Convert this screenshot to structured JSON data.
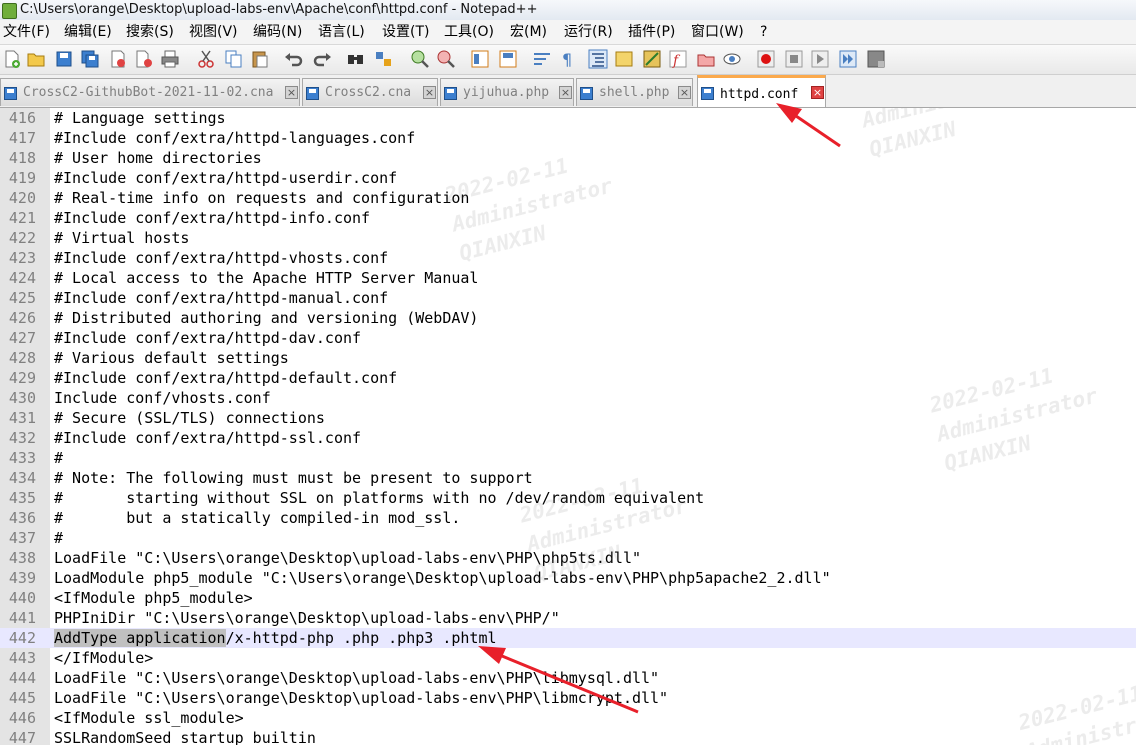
{
  "window": {
    "title": "C:\\Users\\orange\\Desktop\\upload-labs-env\\Apache\\conf\\httpd.conf - Notepad++"
  },
  "menu": [
    "文件(F)",
    "编辑(E)",
    "搜索(S)",
    "视图(V)",
    "编码(N)",
    "语言(L)",
    "设置(T)",
    "工具(O)",
    "宏(M)",
    "运行(R)",
    "插件(P)",
    "窗口(W)",
    "?"
  ],
  "tabs": [
    {
      "label": "CrossC2-GithubBot-2021-11-02.cna",
      "active": false
    },
    {
      "label": "CrossC2.cna",
      "active": false
    },
    {
      "label": "yijuhua.php",
      "active": false
    },
    {
      "label": "shell.php",
      "active": false
    },
    {
      "label": "httpd.conf",
      "active": true
    }
  ],
  "watermark": {
    "date": "2022-02-11",
    "user": "Administrator",
    "org": "QIANXIN"
  },
  "editor": {
    "current_line": "442",
    "lines": [
      {
        "num": "416",
        "text": "# Language settings"
      },
      {
        "num": "417",
        "text": "#Include conf/extra/httpd-languages.conf"
      },
      {
        "num": "418",
        "text": "# User home directories"
      },
      {
        "num": "419",
        "text": "#Include conf/extra/httpd-userdir.conf"
      },
      {
        "num": "420",
        "text": "# Real-time info on requests and configuration"
      },
      {
        "num": "421",
        "text": "#Include conf/extra/httpd-info.conf"
      },
      {
        "num": "422",
        "text": "# Virtual hosts"
      },
      {
        "num": "423",
        "text": "#Include conf/extra/httpd-vhosts.conf"
      },
      {
        "num": "424",
        "text": "# Local access to the Apache HTTP Server Manual"
      },
      {
        "num": "425",
        "text": "#Include conf/extra/httpd-manual.conf"
      },
      {
        "num": "426",
        "text": "# Distributed authoring and versioning (WebDAV)"
      },
      {
        "num": "427",
        "text": "#Include conf/extra/httpd-dav.conf"
      },
      {
        "num": "428",
        "text": "# Various default settings"
      },
      {
        "num": "429",
        "text": "#Include conf/extra/httpd-default.conf"
      },
      {
        "num": "430",
        "text": "Include conf/vhosts.conf"
      },
      {
        "num": "431",
        "text": "# Secure (SSL/TLS) connections"
      },
      {
        "num": "432",
        "text": "#Include conf/extra/httpd-ssl.conf"
      },
      {
        "num": "433",
        "text": "#"
      },
      {
        "num": "434",
        "text": "# Note: The following must must be present to support"
      },
      {
        "num": "435",
        "text": "#       starting without SSL on platforms with no /dev/random equivalent"
      },
      {
        "num": "436",
        "text": "#       but a statically compiled-in mod_ssl."
      },
      {
        "num": "437",
        "text": "#"
      },
      {
        "num": "438",
        "text": "LoadFile \"C:\\Users\\orange\\Desktop\\upload-labs-env\\PHP\\php5ts.dll\""
      },
      {
        "num": "439",
        "text": "LoadModule php5_module \"C:\\Users\\orange\\Desktop\\upload-labs-env\\PHP\\php5apache2_2.dll\""
      },
      {
        "num": "440",
        "text": "<IfModule php5_module>"
      },
      {
        "num": "441",
        "text": "PHPIniDir \"C:\\Users\\orange\\Desktop\\upload-labs-env\\PHP/\""
      },
      {
        "num": "442",
        "text": "",
        "selected": "AddType application",
        "rest": "/x-httpd-php .php .php3 .phtml"
      },
      {
        "num": "443",
        "text": "</IfModule>"
      },
      {
        "num": "444",
        "text": "LoadFile \"C:\\Users\\orange\\Desktop\\upload-labs-env\\PHP\\libmysql.dll\""
      },
      {
        "num": "445",
        "text": "LoadFile \"C:\\Users\\orange\\Desktop\\upload-labs-env\\PHP\\libmcrypt.dll\""
      },
      {
        "num": "446",
        "text": "<IfModule ssl_module>"
      },
      {
        "num": "447",
        "text": "SSLRandomSeed startup builtin"
      }
    ]
  },
  "colors": {
    "gutter": "#e4e4e4",
    "current_line": "#e8e8ff",
    "selection": "#c0c0c0",
    "active_tab_accent": "#fba94c",
    "annotation_arrow": "#e8202a"
  }
}
